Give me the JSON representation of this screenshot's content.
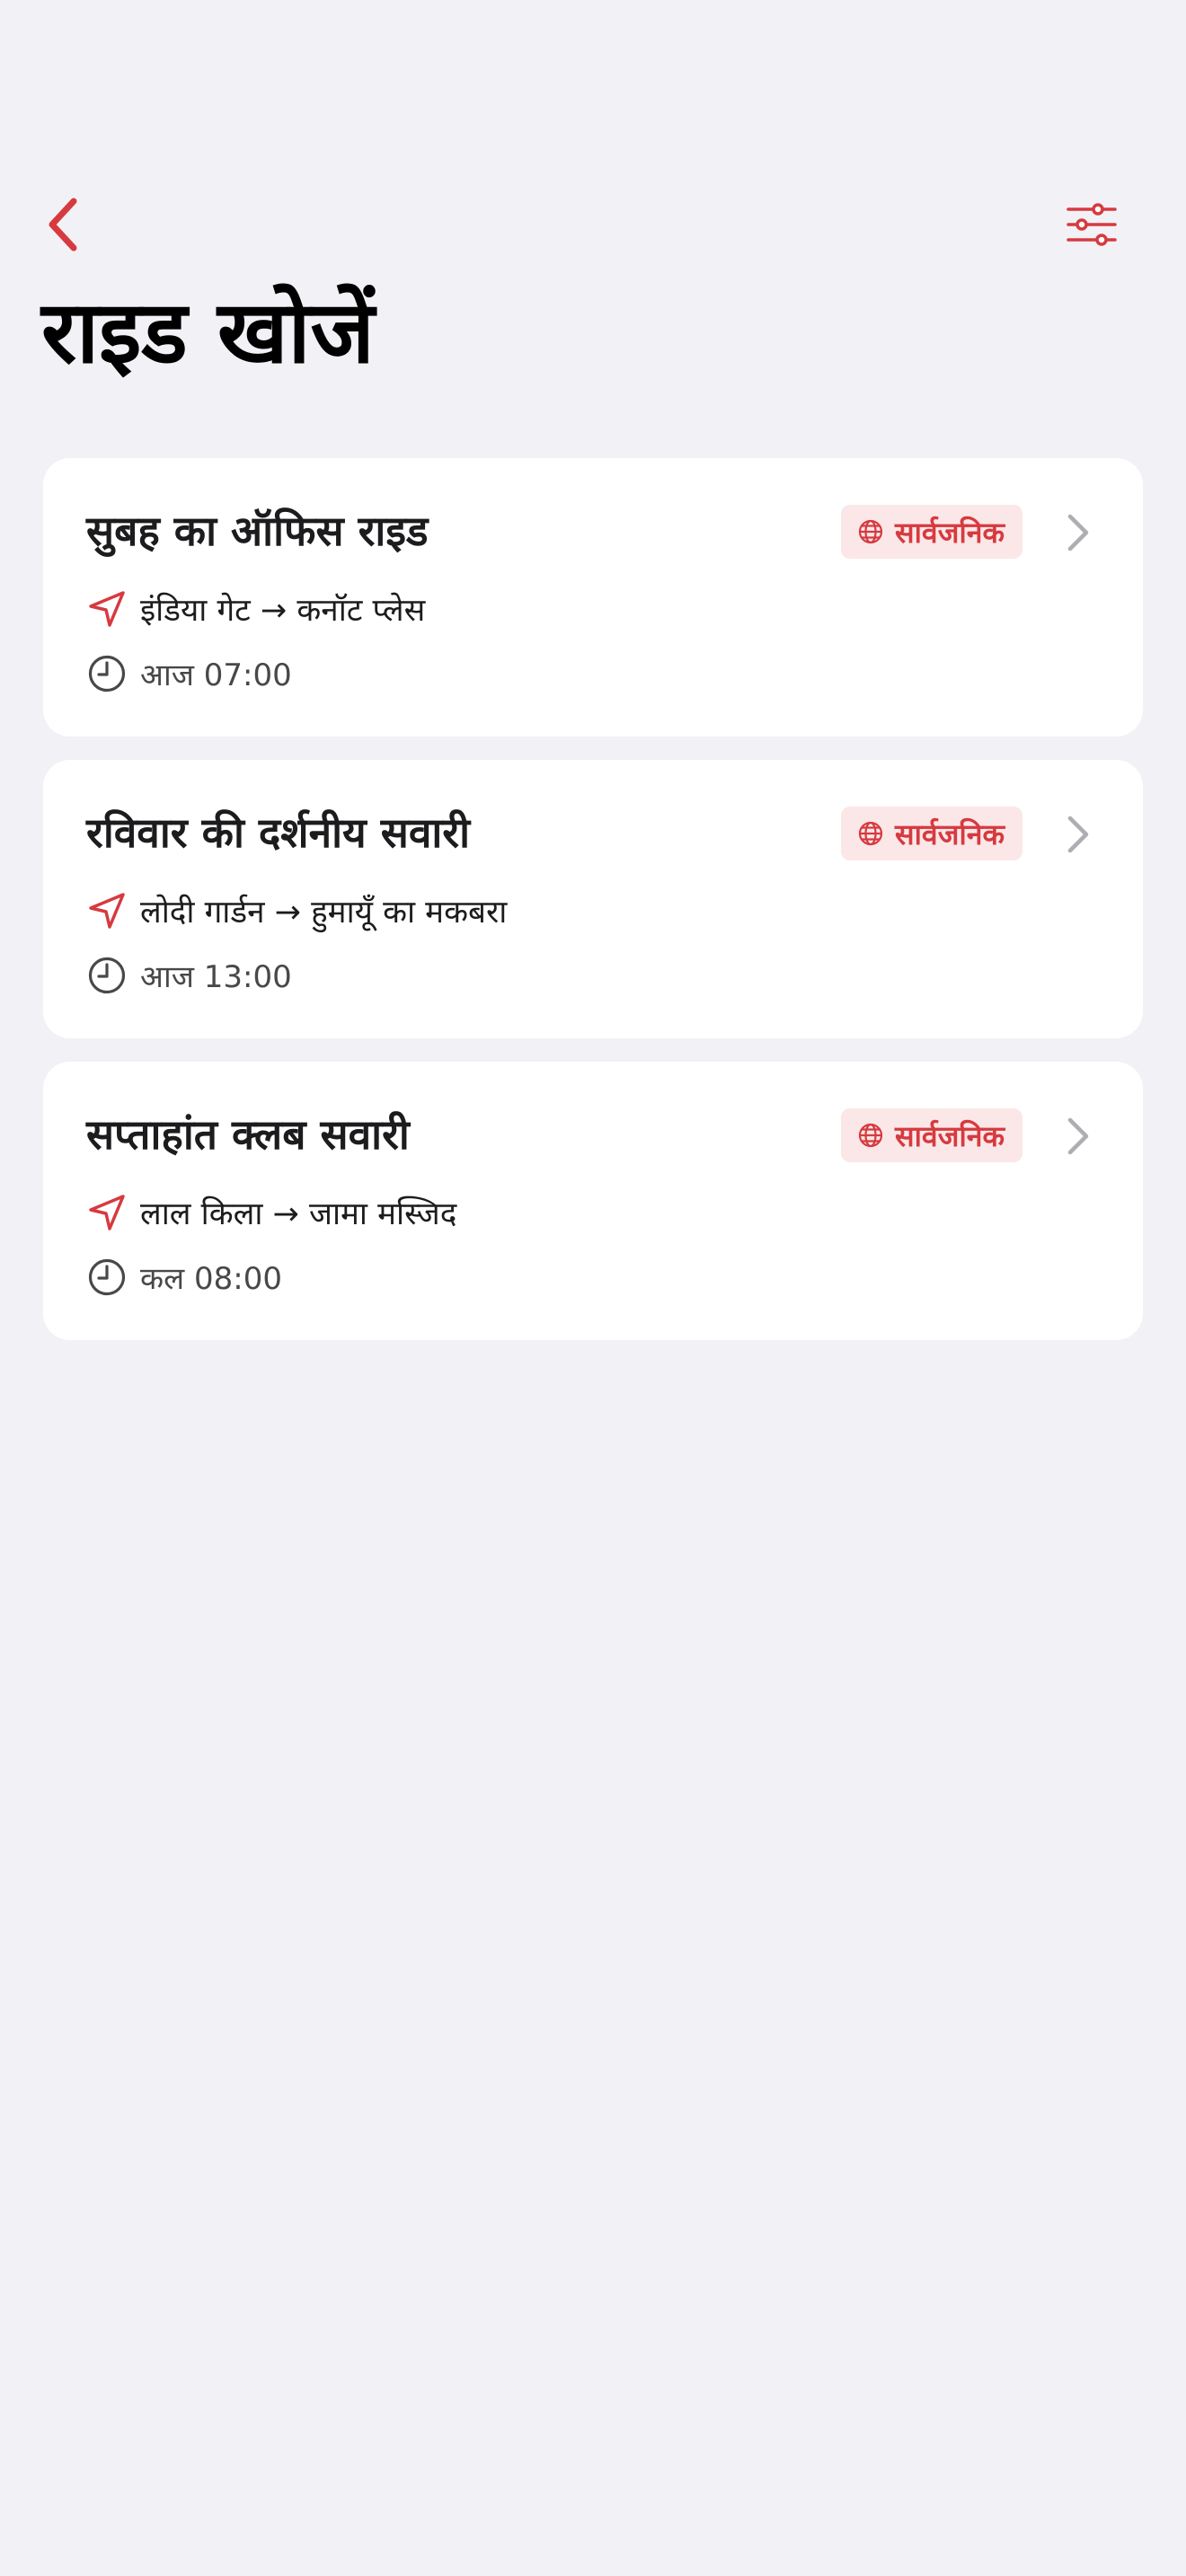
{
  "header": {
    "title": "राइड खोजें",
    "back_icon": "chevron-left-icon",
    "filter_icon": "sliders-icon"
  },
  "colors": {
    "accent": "#d63a3f",
    "badge_background": "#fbe7e8",
    "background": "#f2f1f6",
    "card": "#ffffff"
  },
  "rides": [
    {
      "title": "सुबह का ऑफिस राइड",
      "badge": "सार्वजनिक",
      "route": "इंडिया गेट → कनॉट प्लेस",
      "time": "आज 07:00"
    },
    {
      "title": "रविवार की दर्शनीय सवारी",
      "badge": "सार्वजनिक",
      "route": "लोदी गार्डन → हुमायूँ का मकबरा",
      "time": "आज 13:00"
    },
    {
      "title": "सप्ताहांत क्लब सवारी",
      "badge": "सार्वजनिक",
      "route": "लाल किला → जामा मस्जिद",
      "time": "कल 08:00"
    }
  ]
}
